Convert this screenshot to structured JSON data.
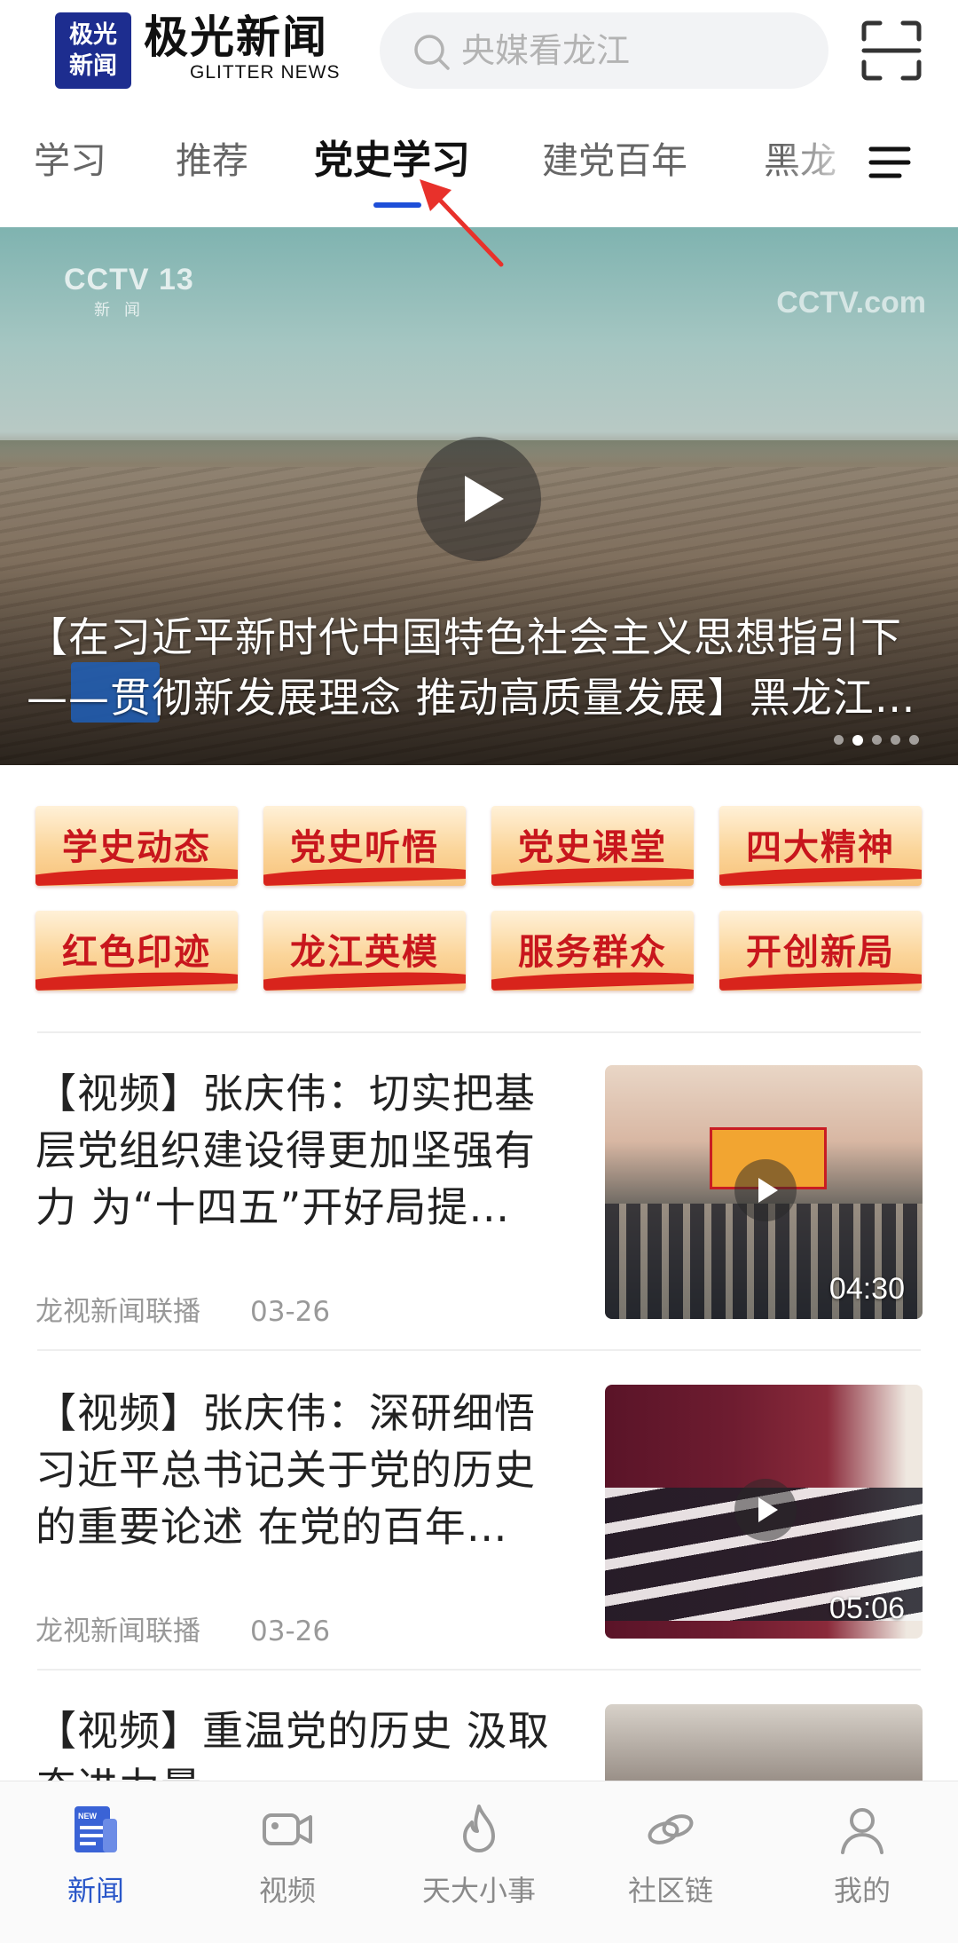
{
  "header": {
    "logo_mark_line1": "极光",
    "logo_mark_line2": "新闻",
    "app_name": "极光新闻",
    "app_name_en": "GLITTER NEWS",
    "search_placeholder": "央媒看龙江"
  },
  "tabs": [
    {
      "label": "学习",
      "active": false
    },
    {
      "label": "推荐",
      "active": false
    },
    {
      "label": "党史学习",
      "active": true
    },
    {
      "label": "建党百年",
      "active": false
    },
    {
      "label": "黑龙",
      "active": false
    }
  ],
  "hero": {
    "watermark_left": "CCTV 13",
    "watermark_left_sub": "新闻",
    "watermark_right": "CCTV.com",
    "title": "【在习近平新时代中国特色社会主义思想指引下——贯彻新发展理念 推动高质量发展】黑龙江：种植户 星风天…",
    "slide_count": 5,
    "active_slide": 2
  },
  "categories": [
    "学史动态",
    "党史听悟",
    "党史课堂",
    "四大精神",
    "红色印迹",
    "龙江英模",
    "服务群众",
    "开创新局"
  ],
  "news": [
    {
      "title": "【视频】张庆伟：切实把基层党组织建设得更加坚强有力 为“十四五”开好局提…",
      "source": "龙视新闻联播",
      "date": "03-26",
      "duration": "04:30"
    },
    {
      "title": "【视频】张庆伟：深研细悟习近平总书记关于党的历史的重要论述 在党的百年…",
      "source": "龙视新闻联播",
      "date": "03-26",
      "duration": "05:06"
    },
    {
      "title": "【视频】重温党的历史 汲取奋进力量",
      "source": "",
      "date": "",
      "duration": ""
    }
  ],
  "bottom_nav": [
    {
      "label": "新闻",
      "icon": "newspaper-icon",
      "active": true
    },
    {
      "label": "视频",
      "icon": "video-camera-icon",
      "active": false
    },
    {
      "label": "天大小事",
      "icon": "flame-icon",
      "active": false
    },
    {
      "label": "社区链",
      "icon": "chain-link-icon",
      "active": false
    },
    {
      "label": "我的",
      "icon": "user-icon",
      "active": false
    }
  ],
  "colors": {
    "accent": "#2a57c9",
    "tab_indicator": "#1e4fd8",
    "category_text": "#c8161d",
    "annotation_arrow": "#e8312b"
  }
}
